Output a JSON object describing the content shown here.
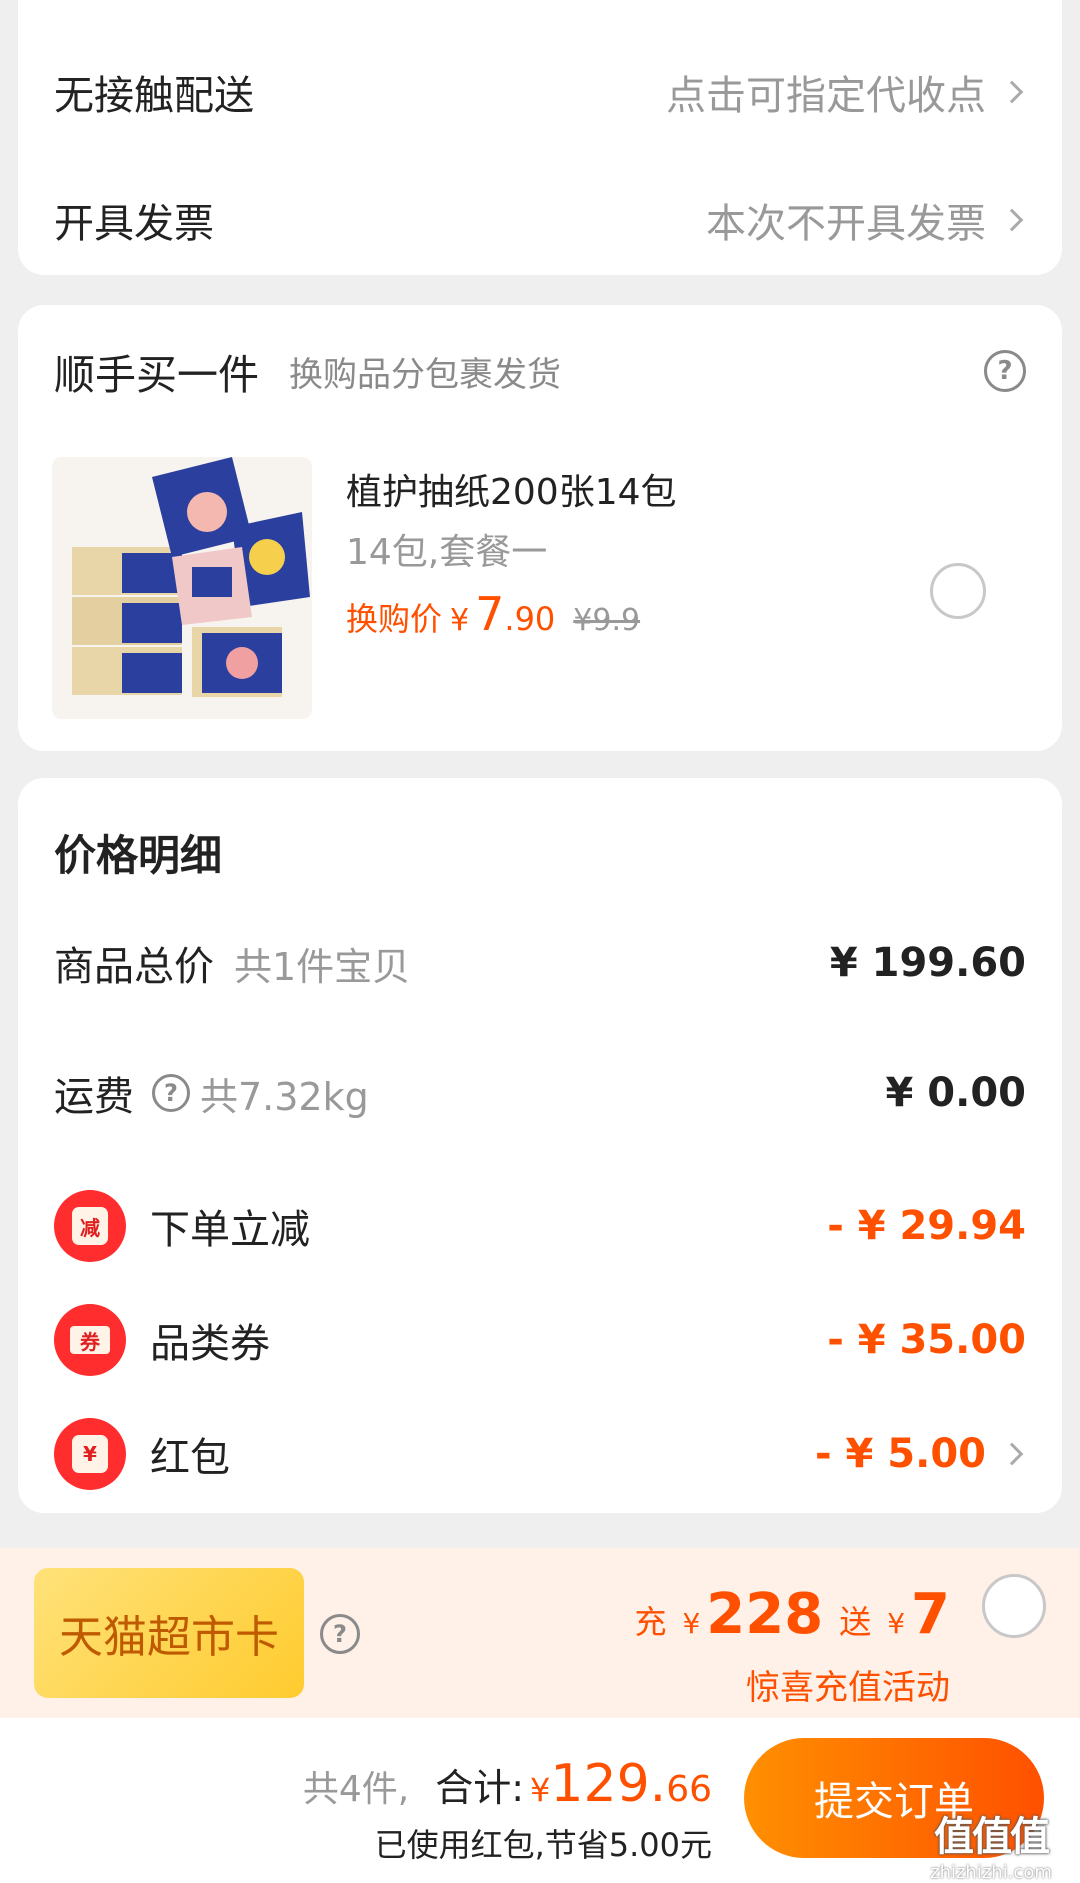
{
  "delivery": {
    "no_contact_label": "无接触配送",
    "no_contact_value": "点击可指定代收点",
    "invoice_label": "开具发票",
    "invoice_value": "本次不开具发票"
  },
  "addon": {
    "title": "顺手买一件",
    "subtitle": "换购品分包裹发货",
    "product": {
      "name": "植护抽纸200张14包",
      "spec": "14包,套餐一",
      "price_prefix": "换购价",
      "currency": "¥",
      "price_int": "7",
      "price_dec": ".90",
      "original_price": "¥9.9"
    }
  },
  "price_detail": {
    "title": "价格明细",
    "goods_total_label": "商品总价",
    "goods_total_note": "共1件宝贝",
    "goods_total_value": "¥ 199.60",
    "shipping_label": "运费",
    "shipping_note": "共7.32kg",
    "shipping_value": "¥ 0.00",
    "discounts": [
      {
        "icon": "instant-discount-icon",
        "glyph": "减",
        "label": "下单立减",
        "value": "- ¥ 29.94"
      },
      {
        "icon": "category-coupon-icon",
        "glyph": "券",
        "label": "品类券",
        "value": "- ¥ 35.00"
      },
      {
        "icon": "red-packet-icon",
        "glyph": "¥",
        "label": "红包",
        "value": "- ¥ 5.00"
      }
    ]
  },
  "tmall_card": {
    "name": "天猫超市卡",
    "charge_label": "充",
    "charge_currency": "¥",
    "charge_amount": "228",
    "bonus_label": "送",
    "bonus_currency": "¥",
    "bonus_amount": "7",
    "promo": "惊喜充值活动"
  },
  "footer": {
    "count": "共4件,",
    "total_label": "合计:",
    "currency": "¥",
    "total_int": "129.",
    "total_dec": "66",
    "savings": "已使用红包,节省5.00元",
    "submit": "提交订单"
  },
  "watermark": {
    "logo": "值值值",
    "domain": "zhizhizhi.com"
  },
  "colors": {
    "accent": "#ff5000",
    "submit_gradient": [
      "#ff9000",
      "#ff5000"
    ],
    "tmall_card_bg": "#fff0e8",
    "card_badge": "#ffd24a"
  }
}
